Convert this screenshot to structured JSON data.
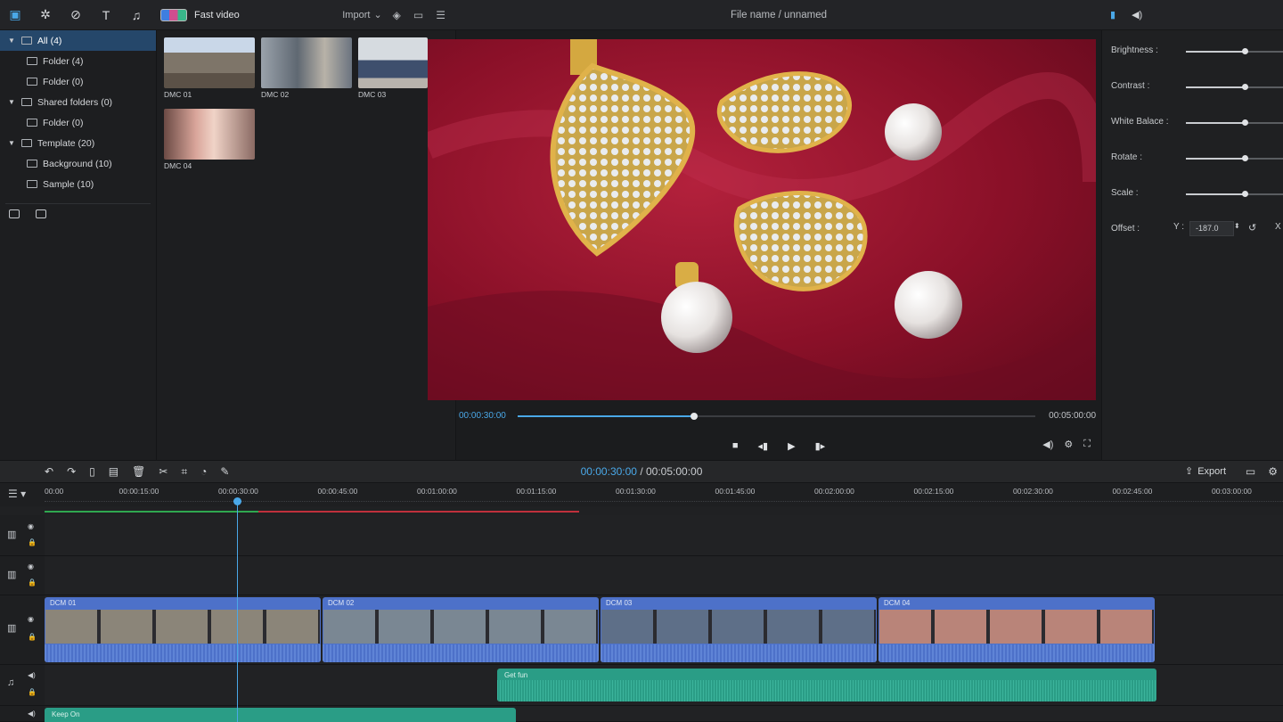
{
  "top_toolbar": {
    "icons": [
      "media-icon",
      "effects-icon",
      "transition-icon",
      "text-icon",
      "music-icon"
    ],
    "fast_video_label": "Fast video",
    "import_label": "Import"
  },
  "sidebar": {
    "items": [
      {
        "label": "All (4)",
        "level": 0,
        "caret": true,
        "selected": true
      },
      {
        "label": "Folder (4)",
        "level": 1,
        "caret": false,
        "selected": false
      },
      {
        "label": "Folder (0)",
        "level": 1,
        "caret": false,
        "selected": false
      },
      {
        "label": "Shared folders (0)",
        "level": 0,
        "caret": true,
        "selected": false
      },
      {
        "label": "Folder (0)",
        "level": 1,
        "caret": false,
        "selected": false
      },
      {
        "label": "Template (20)",
        "level": 0,
        "caret": true,
        "selected": false
      },
      {
        "label": "Background (10)",
        "level": 1,
        "caret": false,
        "selected": false
      },
      {
        "label": "Sample (10)",
        "level": 1,
        "caret": false,
        "selected": false
      }
    ]
  },
  "media": {
    "thumbs": [
      {
        "caption": "DMC 01",
        "color": "#8a8f98"
      },
      {
        "caption": "DMC 02",
        "color": "#9ea3a9"
      },
      {
        "caption": "DMC 03",
        "color": "#6f7f96"
      },
      {
        "caption": "DMC 04",
        "color": "#b98a86"
      }
    ]
  },
  "preview": {
    "file_name": "File name / unnamed",
    "current_time": "00:00:30:00",
    "end_time": "00:05:00:00",
    "progress": 0.34
  },
  "properties": {
    "rows": [
      {
        "label": "Brightness :",
        "value": 0.6
      },
      {
        "label": "Contrast :",
        "value": 0.6
      },
      {
        "label": "White Balace :",
        "value": 0.6
      },
      {
        "label": "Rotate :",
        "value": 0.6
      },
      {
        "label": "Scale :",
        "value": 0.6
      }
    ],
    "offset": {
      "label": "Offset :",
      "y_label": "Y :",
      "y_value": "-187.0",
      "x_label": "X"
    }
  },
  "timeline": {
    "current_time": "00:00:30:00",
    "separator": " / ",
    "total_time": "00:05:00:00",
    "export_label": "Export",
    "ticks": [
      "00:00",
      "00:00:15:00",
      "00:00:30:00",
      "00:00:45:00",
      "00:01:00:00",
      "00:01:15:00",
      "00:01:30:00",
      "00:01:45:00",
      "00:02:00:00",
      "00:02:15:00",
      "00:02:30:00",
      "00:02:45:00",
      "00:03:00:00"
    ],
    "video_clips": [
      {
        "label": "DCM 01",
        "color": "#8b8579"
      },
      {
        "label": "DCM 02",
        "color": "#7a8793"
      },
      {
        "label": "DCM 03",
        "color": "#5e6f88"
      },
      {
        "label": "DCM 04",
        "color": "#b98479"
      }
    ],
    "audio_clips": [
      {
        "label": "Get fun"
      },
      {
        "label": "Keep On"
      }
    ]
  },
  "colors": {
    "accent": "#4aa8e8",
    "video_clip": "#4d71c9",
    "audio_clip": "#2a9d86",
    "render_done": "#2fa84f",
    "render_pending": "#c0303c"
  }
}
